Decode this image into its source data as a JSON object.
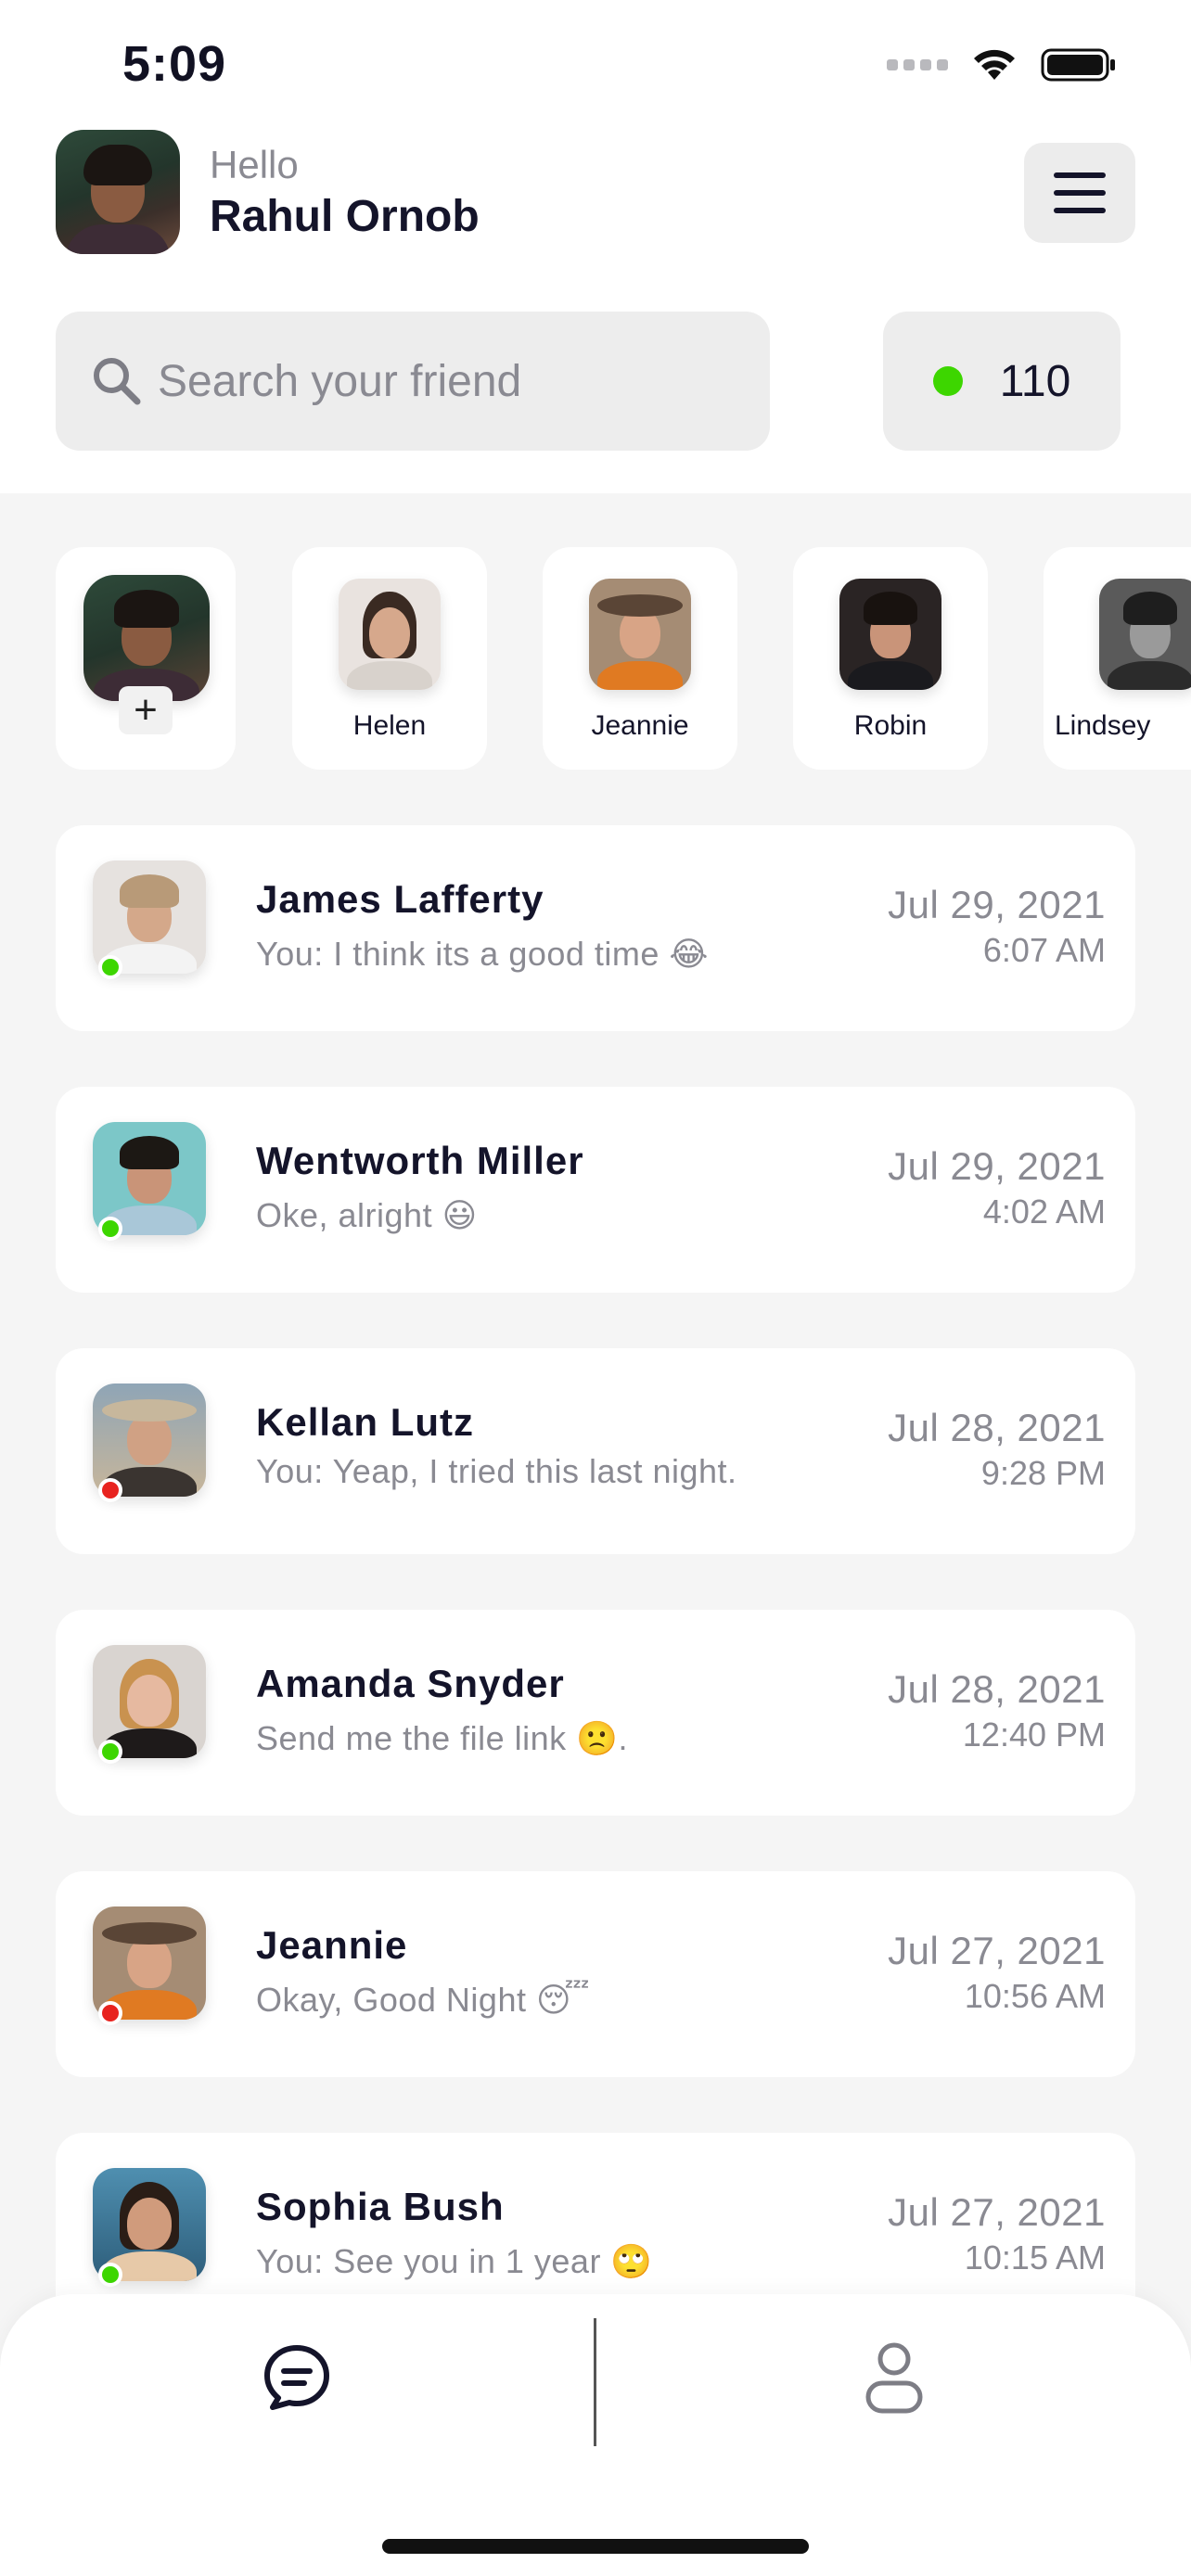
{
  "status_bar": {
    "time": "5:09"
  },
  "header": {
    "greeting": "Hello",
    "username": "Rahul Ornob"
  },
  "search": {
    "placeholder": "Search your friend"
  },
  "online": {
    "count": "110",
    "color": "#3dd600"
  },
  "stories": [
    {
      "name": "Helen"
    },
    {
      "name": "Jeannie"
    },
    {
      "name": "Robin"
    },
    {
      "name": "Lindsey"
    }
  ],
  "add_story": {
    "label": "+"
  },
  "chats": [
    {
      "name": "James Lafferty",
      "message": "You: I think its a good time 😂",
      "date": "Jul 29, 2021",
      "time": "6:07 AM",
      "status": "online"
    },
    {
      "name": "Wentworth Miller",
      "message": "Oke, alright 😃",
      "date": "Jul 29, 2021",
      "time": "4:02 AM",
      "status": "online"
    },
    {
      "name": "Kellan Lutz",
      "message": "You: Yeap, I tried this last night.",
      "date": "Jul 28, 2021",
      "time": "9:28 PM",
      "status": "offline"
    },
    {
      "name": "Amanda Snyder",
      "message": "Send me the file link 🙁.",
      "date": "Jul 28, 2021",
      "time": "12:40 PM",
      "status": "online"
    },
    {
      "name": "Jeannie",
      "message": "Okay, Good Night 😴",
      "date": "Jul 27, 2021",
      "time": "10:56 AM",
      "status": "offline"
    },
    {
      "name": "Sophia Bush",
      "message": "You: See you in 1 year 🙄",
      "date": "Jul 27, 2021",
      "time": "10:15 AM",
      "status": "online"
    }
  ],
  "colors": {
    "online": "#3dd600",
    "offline": "#e8231f"
  },
  "bottom_nav": {
    "items": [
      "chat-icon",
      "profile-icon"
    ]
  }
}
